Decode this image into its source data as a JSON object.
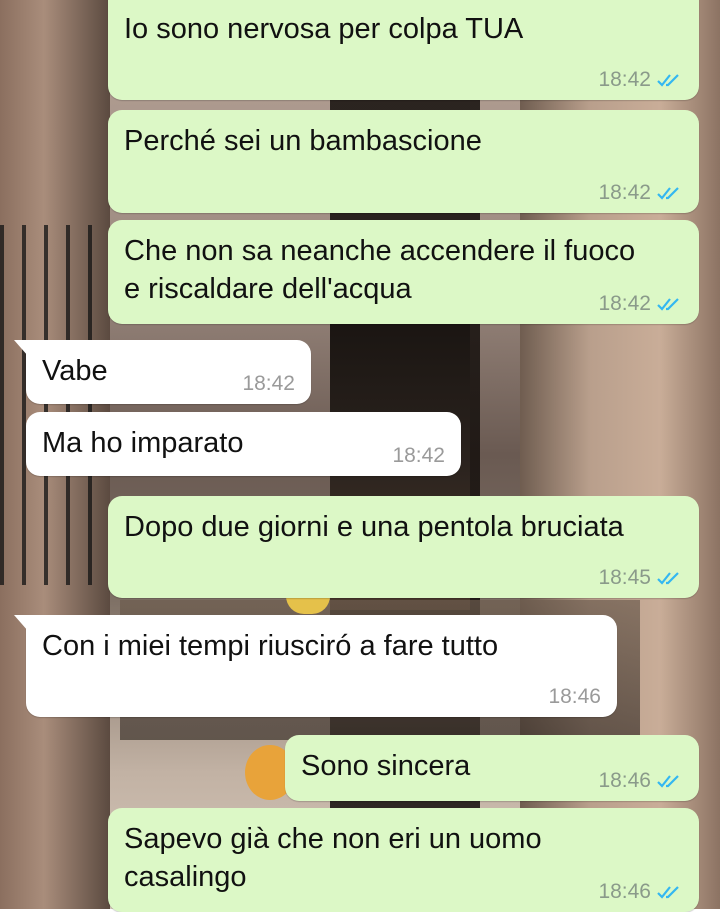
{
  "colors": {
    "outgoing_bubble": "#dcf8c6",
    "incoming_bubble": "#ffffff",
    "read_tick": "#34b7f1"
  },
  "messages": [
    {
      "direction": "out",
      "text": "Io sono nervosa per colpa TUA",
      "time": "18:42",
      "status": "read"
    },
    {
      "direction": "out",
      "text": "Perché sei un bambascione",
      "time": "18:42",
      "status": "read"
    },
    {
      "direction": "out",
      "text": "Che non sa neanche accendere il fuoco\ne riscaldare dell'acqua",
      "time": "18:42",
      "status": "read"
    },
    {
      "direction": "in",
      "text": "Vabe",
      "time": "18:42"
    },
    {
      "direction": "in",
      "text": "Ma ho imparato",
      "time": "18:42"
    },
    {
      "direction": "out",
      "text": "Dopo due giorni e una pentola bruciata",
      "time": "18:45",
      "status": "read"
    },
    {
      "direction": "in",
      "text": "Con i miei tempi riusciró a fare tutto",
      "time": "18:46"
    },
    {
      "direction": "out",
      "text": "Sono sincera",
      "time": "18:46",
      "status": "read"
    },
    {
      "direction": "out",
      "text": "Sapevo già che non eri un uomo\ncasalingo",
      "time": "18:46",
      "status": "read"
    }
  ]
}
